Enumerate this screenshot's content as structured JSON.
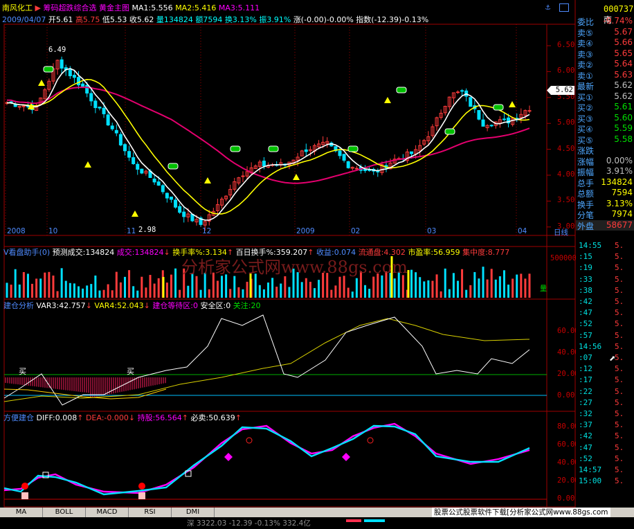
{
  "stock": {
    "name": "南风化工",
    "period_label": "筹码超跌综合选",
    "fund_label": "黄金主图",
    "ma1": "MA1:5.556",
    "ma2": "MA2:5.416",
    "ma3": "MA3:5.111",
    "date": "2009/04/07",
    "open": "开5.61",
    "high": "高5.75",
    "low": "低5.53",
    "close": "收5.62",
    "vol": "量134824",
    "amount": "额7594",
    "turnover": "换3.13%",
    "amplitude": "振3.91%",
    "change": "涨(-0.00)-0.00%",
    "index": "指数(-12.39)-0.13%"
  },
  "price_axis": [
    "6.50",
    "6.00",
    "5.50",
    "5.00",
    "4.50",
    "4.00",
    "3.50",
    "3.00"
  ],
  "price_marker": "5.62",
  "price_labels": {
    "high": "6.49",
    "low": "2.98"
  },
  "time_axis": [
    "2008",
    "10",
    "11",
    "12",
    "2009",
    "02",
    "03",
    "04",
    "日线"
  ],
  "vol_panel": {
    "title": "V看盘助手(0)",
    "pred": "预测成交:134824",
    "vol": "成交:134824",
    "turn": "换手率%:3.134",
    "hundred": "百日换手%:359.207",
    "profit": "收益:0.074",
    "float": "流通盘:4.302",
    "pe": "市盈率:56.959",
    "conc": "集中度:8.777",
    "axis": "500000",
    "side": "量"
  },
  "watermark": "分析家公式网www.88gs.com",
  "build_panel": {
    "title": "建仓分析",
    "var3": "VAR3:42.757",
    "var4": "VAR4:52.043",
    "wait": "建仓等待区:0",
    "safe": "安全区:0",
    "focus": "关注:20",
    "axis": [
      "60.00",
      "40.00",
      "20.00",
      "0.00"
    ],
    "buy": "买"
  },
  "fang_panel": {
    "title": "方便建仓",
    "diff": "DIFF:0.008",
    "dea": "DEA:-0.000",
    "hold": "持股:56.564",
    "sell": "必卖:50.639",
    "axis": [
      "80.00",
      "60.00",
      "40.00",
      "20.00",
      "0.00"
    ]
  },
  "right_panel": {
    "code": "000737",
    "suffix": "南",
    "rows": [
      {
        "label": "委比",
        "value": "-9.74%",
        "color": "#ff3b3b"
      },
      {
        "label": "卖⑤",
        "value": "5.67",
        "color": "#ff3b3b"
      },
      {
        "label": "卖④",
        "value": "5.66",
        "color": "#ff3b3b"
      },
      {
        "label": "卖③",
        "value": "5.65",
        "color": "#ff3b3b"
      },
      {
        "label": "卖②",
        "value": "5.64",
        "color": "#ff3b3b"
      },
      {
        "label": "卖①",
        "value": "5.63",
        "color": "#ff3b3b"
      },
      {
        "label": "最新",
        "value": "5.62",
        "color": "#c0c0c0"
      },
      {
        "label": "买①",
        "value": "5.62",
        "color": "#c0c0c0"
      },
      {
        "label": "买②",
        "value": "5.61",
        "color": "#00e000"
      },
      {
        "label": "买③",
        "value": "5.60",
        "color": "#00e000"
      },
      {
        "label": "买④",
        "value": "5.59",
        "color": "#00e000"
      },
      {
        "label": "买⑤",
        "value": "5.58",
        "color": "#00e000"
      },
      {
        "label": "涨跌",
        "value": "",
        "color": "#c0c0c0"
      },
      {
        "label": "涨幅",
        "value": "0.00%",
        "color": "#c0c0c0"
      },
      {
        "label": "振幅",
        "value": "3.91%",
        "color": "#c0c0c0"
      },
      {
        "label": "总手",
        "value": "134824",
        "color": "#ffff00"
      },
      {
        "label": "总额",
        "value": "7594",
        "color": "#ffff00"
      },
      {
        "label": "换手",
        "value": "3.13%",
        "color": "#ffff00"
      },
      {
        "label": "分笔",
        "value": "7974",
        "color": "#ffff00"
      },
      {
        "label": "外盘",
        "value": "58677",
        "color": "#ff3b3b"
      }
    ],
    "ticks": [
      {
        "t": "14:55",
        "v": "5."
      },
      {
        "t": ":15",
        "v": "5."
      },
      {
        "t": ":19",
        "v": "5."
      },
      {
        "t": ":33",
        "v": "5."
      },
      {
        "t": ":38",
        "v": "5."
      },
      {
        "t": ":42",
        "v": "5."
      },
      {
        "t": ":47",
        "v": "5."
      },
      {
        "t": ":52",
        "v": "5."
      },
      {
        "t": ":57",
        "v": "5."
      },
      {
        "t": "14:56",
        "v": "5."
      },
      {
        "t": ":07",
        "v": "5."
      },
      {
        "t": ":12",
        "v": "5."
      },
      {
        "t": ":17",
        "v": "5."
      },
      {
        "t": ":22",
        "v": "5."
      },
      {
        "t": ":27",
        "v": "5."
      },
      {
        "t": ":32",
        "v": "5."
      },
      {
        "t": ":37",
        "v": "5."
      },
      {
        "t": ":42",
        "v": "5."
      },
      {
        "t": ":47",
        "v": "5."
      },
      {
        "t": ":52",
        "v": "5."
      },
      {
        "t": "14:57",
        "v": "5."
      },
      {
        "t": "15:00",
        "v": "5."
      }
    ]
  },
  "tabs": [
    "MA",
    "BOLL",
    "MACD",
    "RSI",
    "DMI"
  ],
  "footer_text": "股票公式股票软件下载[分析家公式网www.88gs.com",
  "status_text": "深 3322.03 -12.39 -0.13% 332.4亿"
}
